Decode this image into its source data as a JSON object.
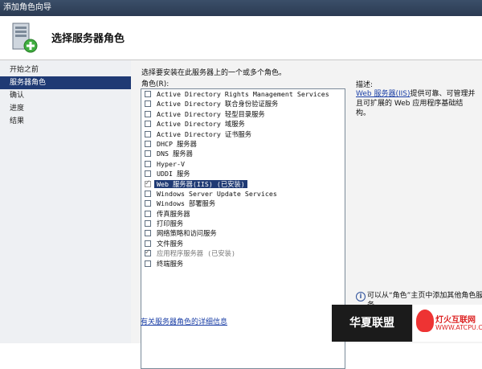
{
  "window": {
    "title": "添加角色向导"
  },
  "header": {
    "title": "选择服务器角色"
  },
  "sidebar": {
    "items": [
      {
        "label": "开始之前",
        "active": false
      },
      {
        "label": "服务器角色",
        "active": true
      },
      {
        "label": "确认",
        "active": false
      },
      {
        "label": "进度",
        "active": false
      },
      {
        "label": "结果",
        "active": false
      }
    ]
  },
  "main": {
    "instruction": "选择要安装在此服务器上的一个或多个角色。",
    "roles_label": "角色(R):",
    "roles": [
      {
        "label": "Active Directory Rights Management Services",
        "checked": false
      },
      {
        "label": "Active Directory 联合身份验证服务",
        "checked": false
      },
      {
        "label": "Active Directory 轻型目录服务",
        "checked": false
      },
      {
        "label": "Active Directory 域服务",
        "checked": false
      },
      {
        "label": "Active Directory 证书服务",
        "checked": false
      },
      {
        "label": "DHCP 服务器",
        "checked": false
      },
      {
        "label": "DNS 服务器",
        "checked": false
      },
      {
        "label": "Hyper-V",
        "checked": false
      },
      {
        "label": "UDDI 服务",
        "checked": false
      },
      {
        "label": "Web 服务器(IIS)  (已安装)",
        "checked": true,
        "selected": true,
        "installed": true
      },
      {
        "label": "Windows Server Update Services",
        "checked": false
      },
      {
        "label": "Windows 部署服务",
        "checked": false
      },
      {
        "label": "传真服务器",
        "checked": false
      },
      {
        "label": "打印服务",
        "checked": false
      },
      {
        "label": "网络策略和访问服务",
        "checked": false
      },
      {
        "label": "文件服务",
        "checked": false
      },
      {
        "label": "应用程序服务器  (已安装)",
        "checked": true,
        "installed": true
      },
      {
        "label": "终端服务",
        "checked": false
      }
    ],
    "details_link": "有关服务器角色的详细信息"
  },
  "description": {
    "title": "描述:",
    "link_text": "Web 服务器(IIS)",
    "text": "提供可靠、可管理并且可扩展的 Web 应用程序基础结构。"
  },
  "info": {
    "text": "可以从“角色”主页中添加其他角色服务。"
  },
  "watermark": {
    "text": "华夏联盟",
    "site_name": "灯火互联网",
    "site_url": "WWW.ATCPU.COM"
  }
}
